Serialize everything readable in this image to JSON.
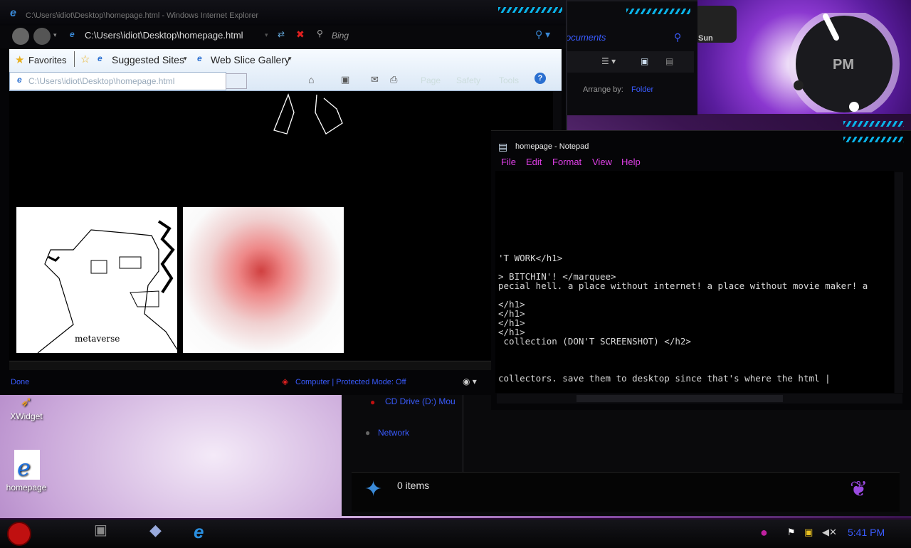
{
  "ie": {
    "title": "C:\\Users\\idiot\\Desktop\\homepage.html - Windows Internet Explorer",
    "address": "C:\\Users\\idiot\\Desktop\\homepage.html",
    "search_placeholder": "Bing",
    "favorites_label": "Favorites",
    "suggested_sites": "Suggested Sites",
    "web_slice_gallery": "Web Slice Gallery",
    "tab_title": "C:\\Users\\idiot\\Desktop\\homepage.html",
    "cmd_page": "Page",
    "cmd_safety": "Safety",
    "cmd_tools": "Tools",
    "status_done": "Done",
    "status_zone": "Computer | Protected Mode: Off",
    "image1_caption": "metaverse"
  },
  "explorer": {
    "documents_label": "ocuments",
    "arrange_by_label": "Arrange by:",
    "arrange_by_value": "Folder",
    "cd_drive": "CD Drive (D:) Mou",
    "network": "Network",
    "items_count": "0 items"
  },
  "gadget": {
    "day": "Sun",
    "ampm": "PM"
  },
  "notepad": {
    "title": "homepage - Notepad",
    "menu": [
      "File",
      "Edit",
      "Format",
      "View",
      "Help"
    ],
    "lines": [
      "'T WORK</h1>",
      "",
      "> BITCHIN'! </marquee>",
      "pecial hell. a place without internet! a place without movie maker! a",
      "",
      "</h1>",
      "</h1>",
      "</h1>",
      "</h1>",
      " collection (DON'T SCREENSHOT) </h2>",
      "",
      "",
      "",
      "collectors. save them to desktop since that's where the html |"
    ]
  },
  "desktop": {
    "icons": [
      {
        "label": "XWidget"
      },
      {
        "label": "homepage"
      }
    ]
  },
  "taskbar": {
    "time": "5:41 PM"
  },
  "colors": {
    "accent": "#e040e8",
    "link_blue": "#3a5cff",
    "stripe": "#0ab3e8"
  }
}
